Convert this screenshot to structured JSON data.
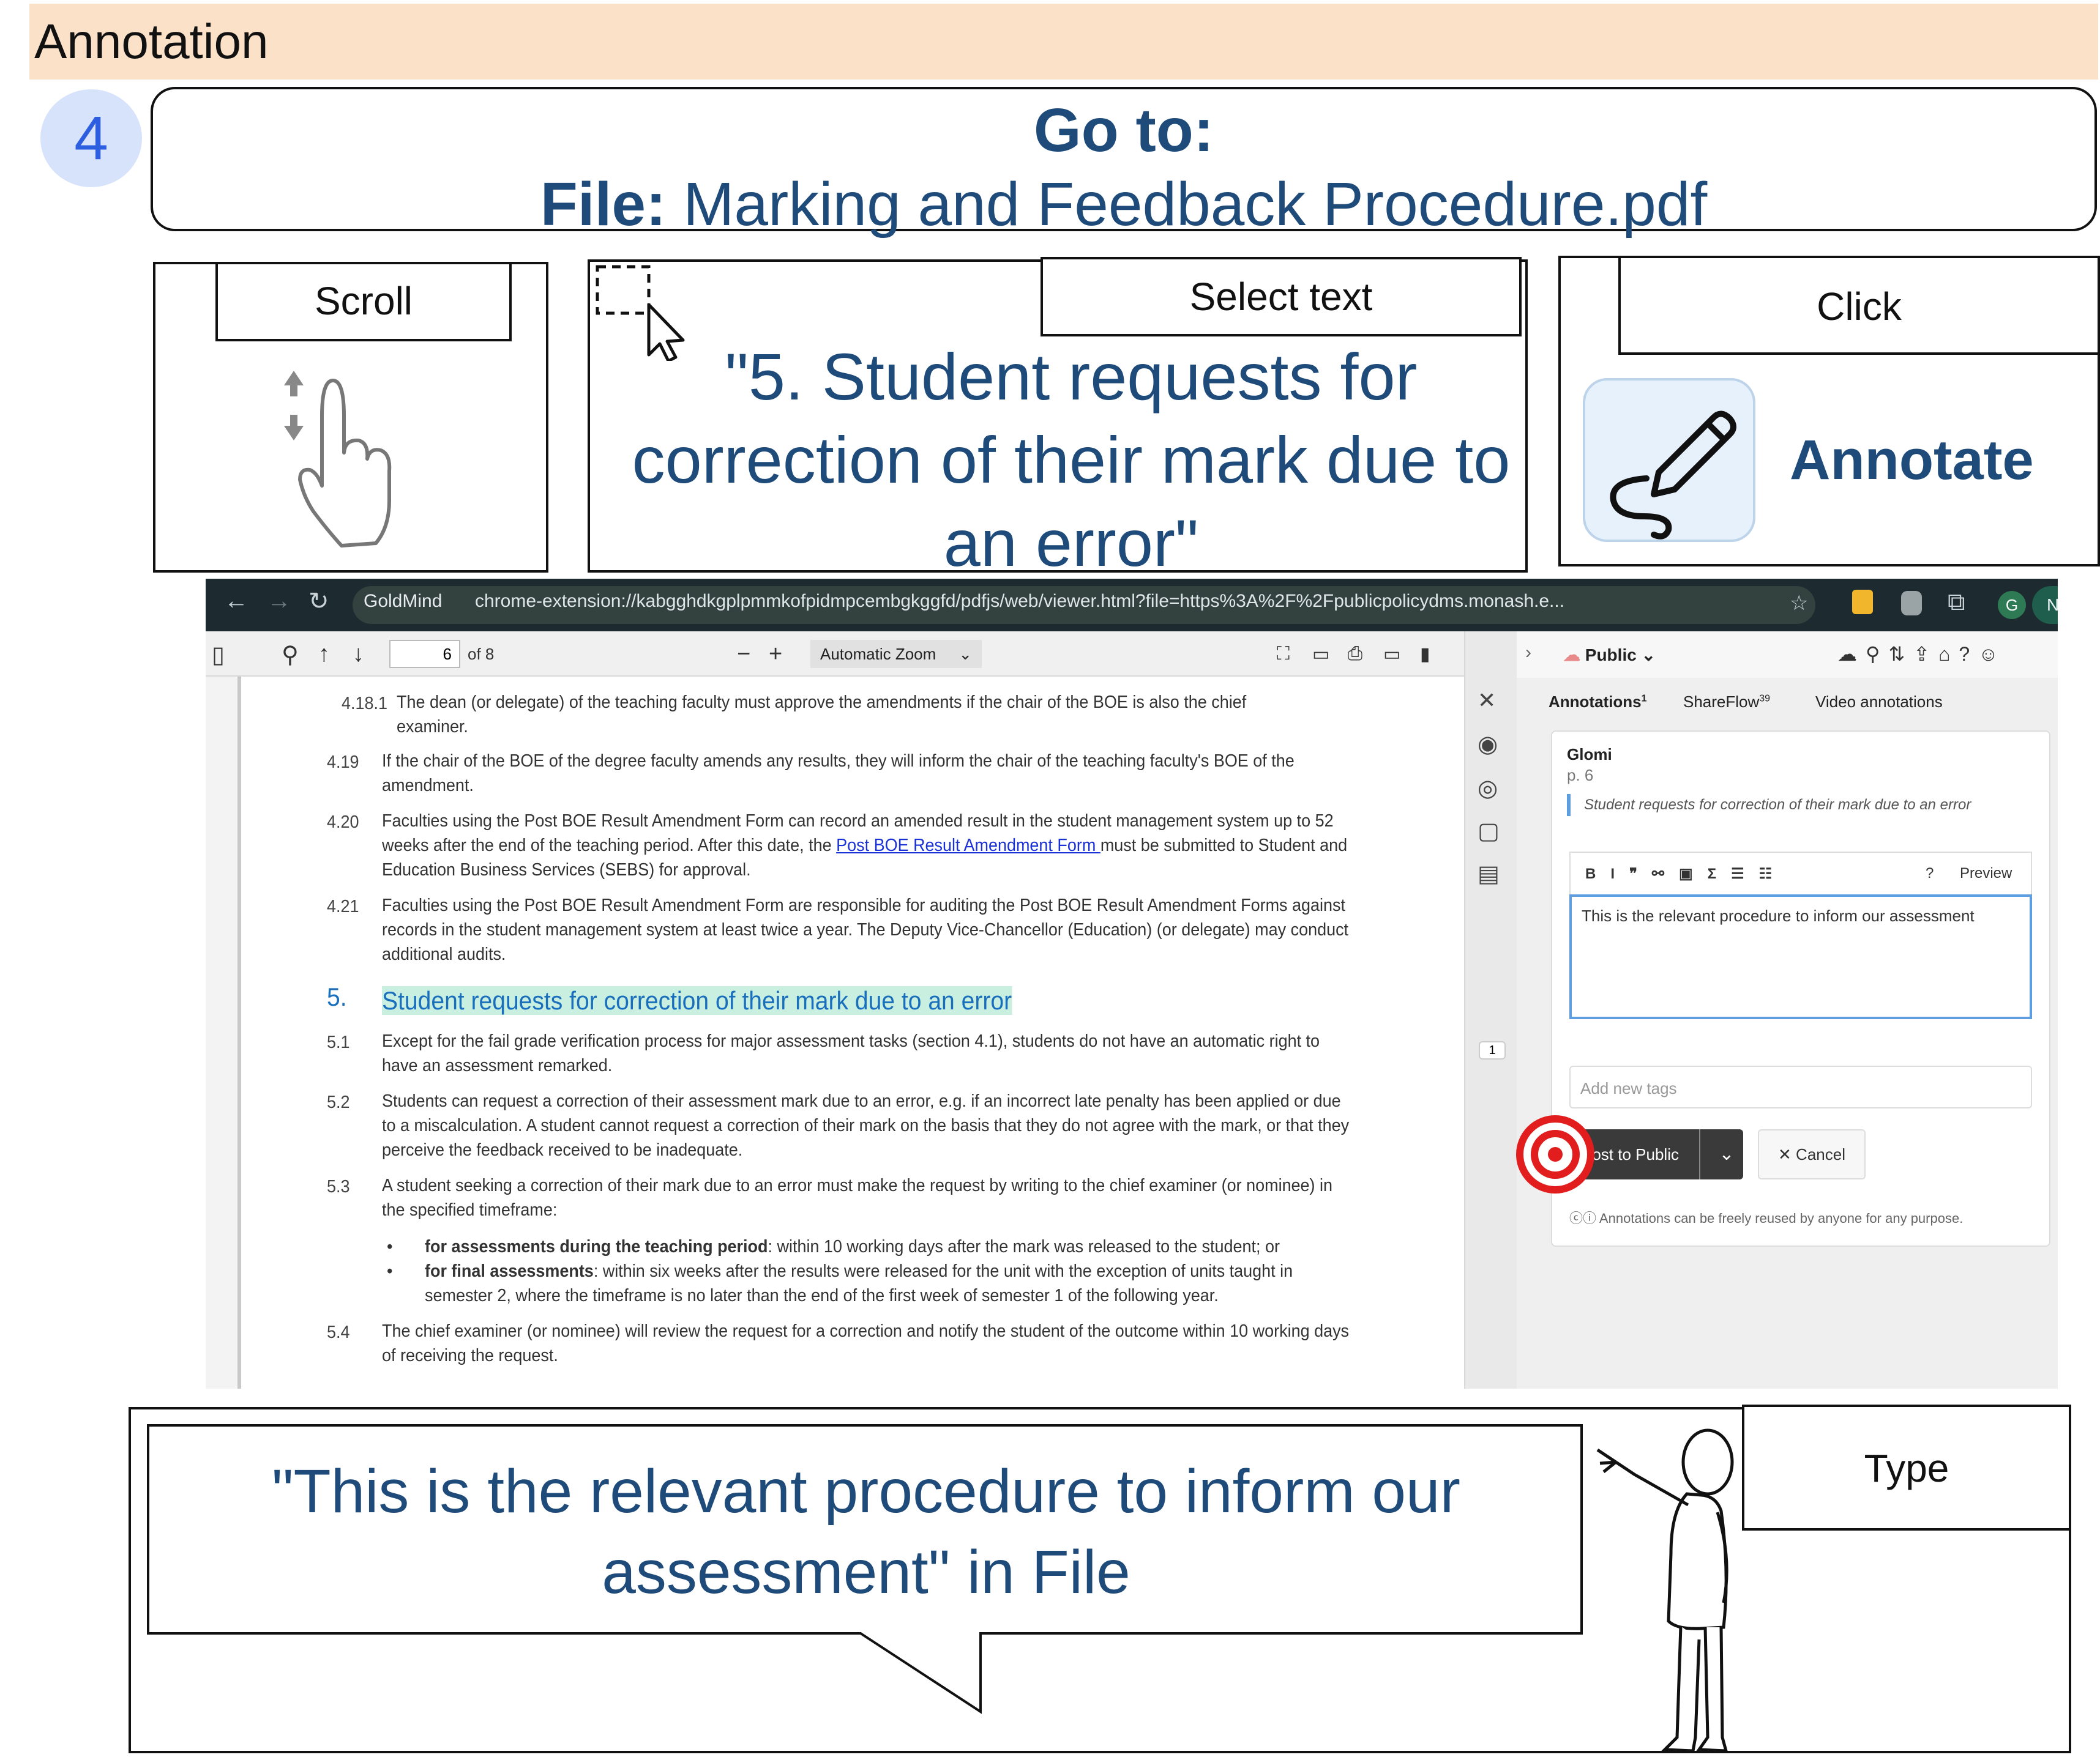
{
  "header": {
    "title": "Annotation",
    "step_number": "4"
  },
  "goto": {
    "title": "Go to:",
    "file_label": "File:",
    "file_name": "Marking and Feedback Procedure.pdf"
  },
  "actions": {
    "scroll": {
      "label": "Scroll"
    },
    "select": {
      "label": "Select text",
      "quote": "\"5. Student requests for correction of their mark due to an error\""
    },
    "click": {
      "label": "Click",
      "button_label": "Annotate"
    },
    "type": {
      "label": "Type",
      "quote": "\"This is the relevant procedure to inform our assessment\" in File"
    }
  },
  "browser": {
    "extension_chip": "GoldMind",
    "url": "chrome-extension://kabgghdkgplpmmkofpidmpcembgkggfd/pdfjs/web/viewer.html?file=https%3A%2F%2Fpublicpolicydms.monash.e...",
    "avatar_letter": "G",
    "update_badge": "New Chrome available"
  },
  "pdf_toolbar": {
    "page_current": "6",
    "page_total": "of 8",
    "zoom": "Automatic Zoom"
  },
  "document": {
    "p4181": {
      "num": "4.18.1",
      "lines": [
        "The dean (or delegate) of the teaching faculty must approve the amendments if the chair of the BOE is also the chief",
        "examiner."
      ]
    },
    "p419": {
      "num": "4.19",
      "lines": [
        "If the chair of the BOE of the degree faculty amends any results, they will inform the chair of the teaching faculty's BOE of the",
        "amendment."
      ]
    },
    "p420": {
      "num": "4.20",
      "line1": "Faculties using the Post BOE Result Amendment Form can record an amended result in the student management system up to 52",
      "line2_pre": "weeks after the end of the teaching period. After this date, the ",
      "line2_link": "Post BOE Result Amendment Form ",
      "line2_post": "must be submitted to Student and",
      "line3": "Education Business Services (SEBS) for approval."
    },
    "p421": {
      "num": "4.21",
      "lines": [
        "Faculties using the Post BOE Result Amendment Form are responsible for auditing the Post BOE Result Amendment Forms against",
        "records in the student management system at least twice a year. The Deputy Vice-Chancellor (Education) (or delegate) may conduct",
        "additional audits."
      ]
    },
    "sec5": {
      "num": "5.",
      "title": "Student requests for correction of their mark due to an error"
    },
    "p51": {
      "num": "5.1",
      "lines": [
        "Except for the fail grade verification process for major assessment tasks (section 4.1), students do not have an automatic right to",
        "have an assessment remarked."
      ]
    },
    "p52": {
      "num": "5.2",
      "lines": [
        "Students can request a correction of their assessment mark due to an error, e.g. if an incorrect late penalty has been applied or due",
        "to a miscalculation. A student cannot request a correction of their mark on the basis that they do not agree with the mark, or that they",
        "perceive the feedback received to be inadequate."
      ]
    },
    "p53": {
      "num": "5.3",
      "lines": [
        "A student seeking a correction of their mark due to an error must make the request by writing to the chief examiner (or nominee) in",
        "the specified timeframe:"
      ]
    },
    "b1": {
      "bold": "for assessments during the teaching period",
      "rest": ": within 10 working days after the mark was released to the student; or"
    },
    "b2": {
      "bold": "for final assessments",
      "rest": ": within six weeks after the results were released for the unit with the exception of units taught in",
      "line2": "semester 2, where the timeframe is no later than the end of the first week of semester 1 of the following year."
    },
    "p54": {
      "num": "5.4",
      "lines": [
        "The chief examiner (or nominee) will review the request for a correction and notify the student of the outcome within 10 working days",
        "of receiving the request."
      ]
    }
  },
  "side_panel": {
    "visibility": "Public",
    "tabs": {
      "annotations": "Annotations",
      "annotations_count": "1",
      "shareflow": "ShareFlow",
      "shareflow_count": "39",
      "video": "Video annotations"
    },
    "rail_badge": "1",
    "card": {
      "user": "Glomi",
      "page": "p. 6",
      "quote": "Student requests for correction of their mark due to an error",
      "preview": "Preview",
      "help": "?",
      "editor_text": "This is the relevant procedure to inform our assessment",
      "tags_placeholder": "Add new tags",
      "post": "Post to Public",
      "cancel": "Cancel",
      "license": "Annotations can be freely reused by anyone for any purpose."
    }
  },
  "colors": {
    "header_bg": "#fbe1c8",
    "instruction_text": "#1f4b7a",
    "step_circle": "#d6e3fa",
    "section_highlight": "#c8efe0",
    "target": "#e11d1d"
  },
  "icons": [
    "scroll-hand-icon",
    "text-select-cursor-icon",
    "annotate-pen-icon",
    "target-icon",
    "pointing-person-illustration"
  ]
}
